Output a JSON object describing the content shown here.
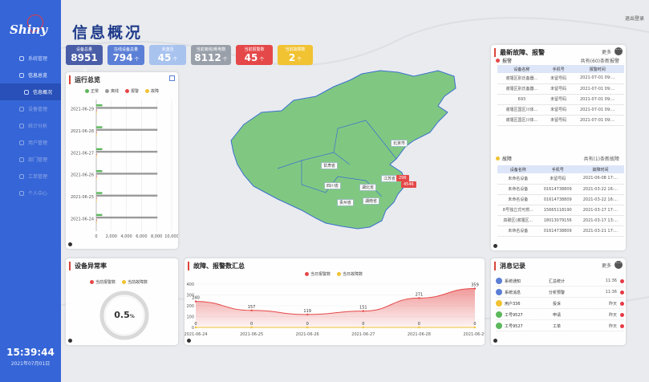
{
  "sidebar": {
    "logo": "Shiny",
    "menu": [
      "系统管理",
      "信息总览",
      "信息概况",
      "设备管理",
      "统计分析",
      "用户管理",
      "部门管理",
      "工单管理",
      "个人中心"
    ],
    "clock": "15:39:44",
    "date": "2021年07月01日"
  },
  "header": {
    "title": "信息概况",
    "logout": "退出登录"
  },
  "stats": [
    {
      "label": "设备总量",
      "value": "8951",
      "unit": "个",
      "color": "#4a5ea8"
    },
    {
      "label": "在线设备总量",
      "value": "794",
      "unit": "个",
      "color": "#5b7fd6"
    },
    {
      "label": "未激活",
      "value": "45",
      "unit": "个",
      "color": "#a9c3ef"
    },
    {
      "label": "当前离线/断电数",
      "value": "8112",
      "unit": "个",
      "color": "#9aa0aa"
    },
    {
      "label": "当前报警数",
      "value": "45",
      "unit": "个",
      "color": "#e54848"
    },
    {
      "label": "当前故障数",
      "value": "2",
      "unit": "个",
      "color": "#f1c232"
    }
  ],
  "map": {
    "labels": [
      "北京市",
      "甘肃省",
      "四川省",
      "湖北省",
      "江苏省",
      "湖南省",
      "贵州省"
    ],
    "badges": [
      "296",
      "4546"
    ]
  },
  "overview": {
    "title": "运行总览",
    "legend": [
      "正常",
      "离线",
      "报警",
      "故障"
    ],
    "colors": [
      "#5cb85c",
      "#9a9a9a",
      "#e54848",
      "#f1c232"
    ]
  },
  "abnormal": {
    "title": "设备异常率",
    "legend": [
      "当前报警数",
      "当前故障数"
    ],
    "value": "0.5",
    "unit": "%"
  },
  "summary": {
    "title": "故障、报警数汇总",
    "legend": [
      "当日报警数",
      "当日故障数"
    ]
  },
  "latest": {
    "title": "最新故障、报警",
    "more": "更多",
    "alarm": {
      "label": "报警",
      "count": "共有(60)条新报警",
      "headers": [
        "设备名称",
        "手机号",
        "报警时间"
      ],
      "rows": [
        [
          "谢堰区别氏备器...",
          "未留号码",
          "2021-07-01 09:..."
        ],
        [
          "谢堰区别氏备器...",
          "未留号码",
          "2021-07-01 09:..."
        ],
        [
          "693",
          "未留号码",
          "2021-07-01 09:..."
        ],
        [
          "谢堰区国区川体...",
          "未留号码",
          "2021-07-01 09:..."
        ],
        [
          "谢堰区国区川体...",
          "未留号码",
          "2021-07-01 09:..."
        ]
      ]
    },
    "fault": {
      "label": "故障",
      "count": "共有(1)条新故障",
      "headers": [
        "设备名称",
        "手机号",
        "故障时间"
      ],
      "rows": [
        [
          "未命名设备",
          "未留号码",
          "2021-06-08 17:..."
        ],
        [
          "未命名设备",
          "01614738809",
          "2021-03-22 16:..."
        ],
        [
          "未命名设备",
          "01614738809",
          "2021-03-22 16:..."
        ],
        [
          "8号独立式可燃...",
          "15665118190",
          "2021-03-17 17:..."
        ],
        [
          "高碳区(谢堰区...",
          "18013079156",
          "2021-03-17 13:..."
        ],
        [
          "未命名设备",
          "01614738809",
          "2021-03-21 17:..."
        ]
      ]
    }
  },
  "messages": {
    "title": "消息记录",
    "more": "更多",
    "rows": [
      {
        "type": "系统通知",
        "action": "汇总统计",
        "time": "11:36",
        "color": "#5b7fd6"
      },
      {
        "type": "系统消息",
        "action": "分析预警",
        "time": "11:36",
        "color": "#5b7fd6"
      },
      {
        "type": "用户336",
        "action": "投诉",
        "time": "昨天",
        "color": "#f1c232"
      },
      {
        "type": "工号9527",
        "action": "申请",
        "time": "昨天",
        "color": "#5cb85c"
      },
      {
        "type": "工号9527",
        "action": "工单",
        "time": "昨天",
        "color": "#5cb85c"
      }
    ]
  },
  "chart_data": [
    {
      "type": "bar",
      "title": "运行总览",
      "categories": [
        "2021-06-29",
        "2021-06-28",
        "2021-06-27",
        "2021-06-26",
        "2021-06-25",
        "2021-06-24"
      ],
      "series": [
        {
          "name": "正常",
          "values": [
            794,
            794,
            794,
            794,
            794,
            794
          ]
        },
        {
          "name": "离线",
          "values": [
            8112,
            8112,
            8112,
            8112,
            8112,
            8112
          ]
        },
        {
          "name": "报警",
          "values": [
            45,
            45,
            45,
            45,
            45,
            45
          ]
        },
        {
          "name": "故障",
          "values": [
            2,
            2,
            2,
            2,
            2,
            2
          ]
        }
      ],
      "xlim": [
        0,
        10000
      ],
      "xticks": [
        "0",
        "2,000",
        "4,000",
        "6,000",
        "8,000",
        "10,000"
      ]
    },
    {
      "type": "area",
      "title": "故障、报警数汇总",
      "categories": [
        "2021-06-24",
        "2021-06-25",
        "2021-06-26",
        "2021-06-27",
        "2021-06-28",
        "2021-06-29"
      ],
      "series": [
        {
          "name": "当日报警数",
          "values": [
            240,
            157,
            119,
            151,
            271,
            359
          ]
        },
        {
          "name": "当日故障数",
          "values": [
            0,
            0,
            0,
            0,
            0,
            0
          ]
        }
      ],
      "ylim": [
        0,
        400
      ],
      "yticks": [
        "0",
        "100",
        "200",
        "300",
        "400"
      ]
    }
  ]
}
